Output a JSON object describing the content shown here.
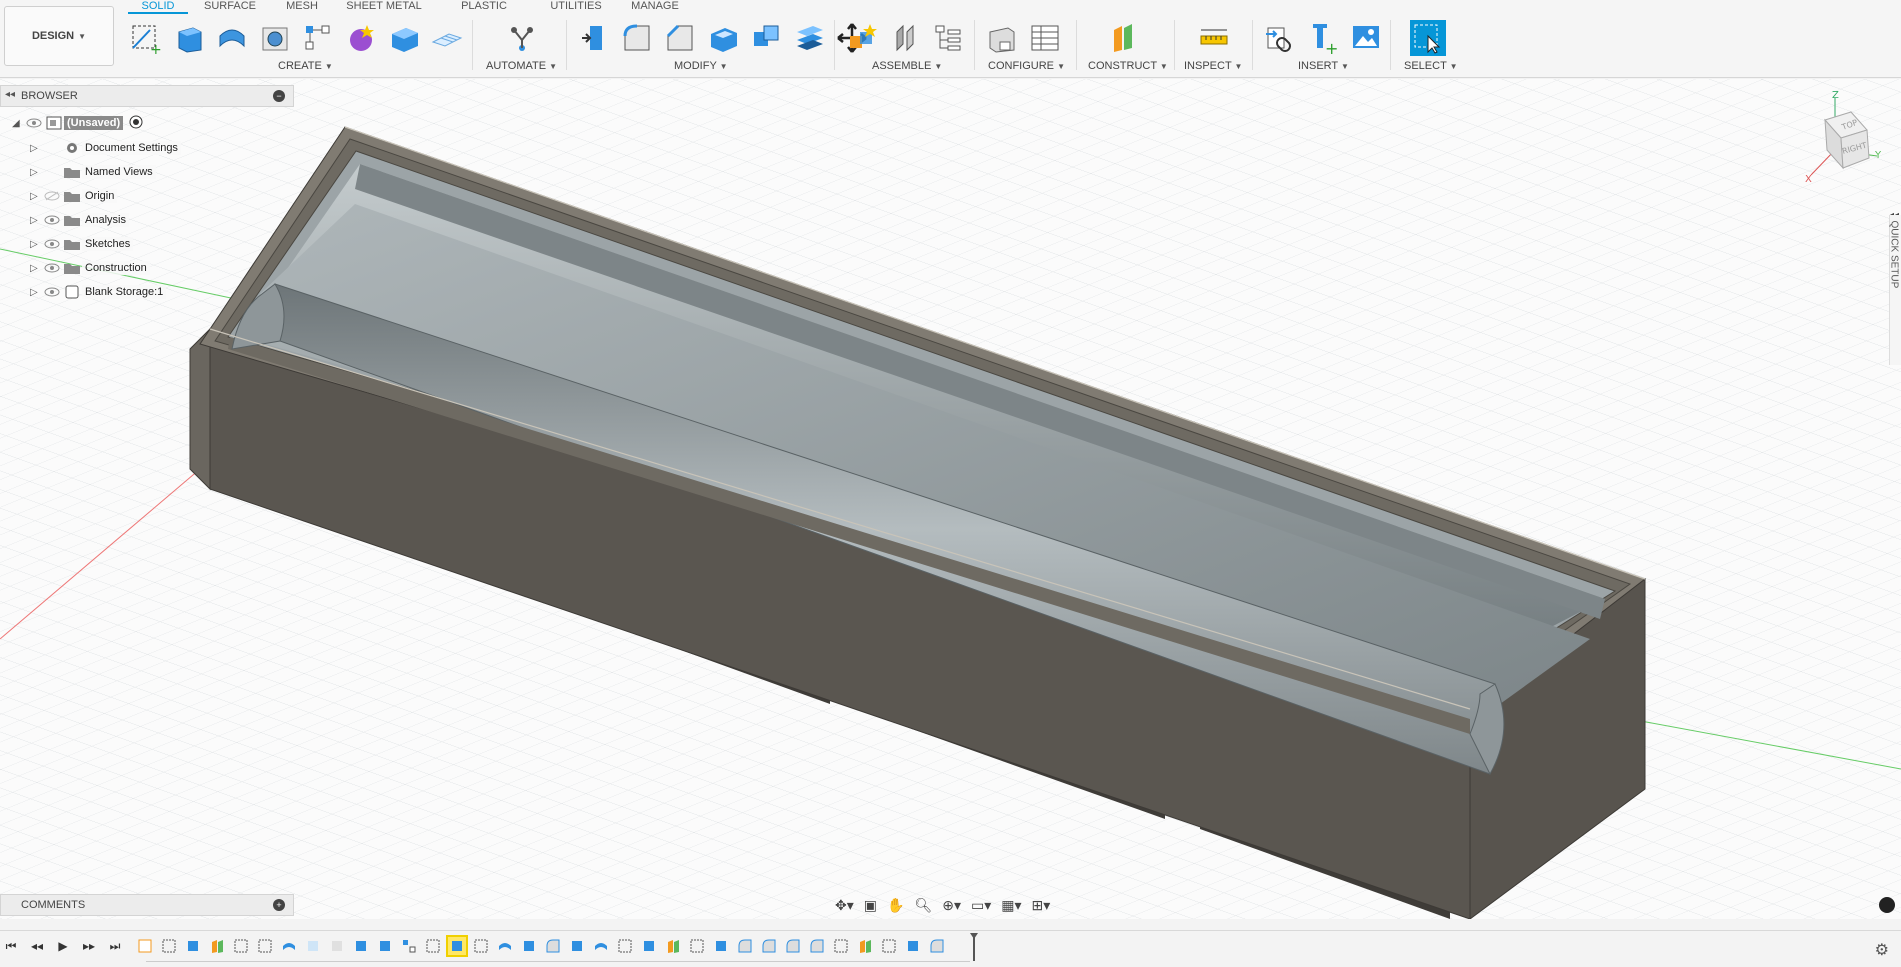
{
  "app": {
    "workspace_label": "DESIGN"
  },
  "tabs": [
    {
      "label": "SOLID",
      "active": true
    },
    {
      "label": "SURFACE",
      "active": false
    },
    {
      "label": "MESH",
      "active": false
    },
    {
      "label": "SHEET METAL",
      "active": false
    },
    {
      "label": "PLASTIC",
      "active": false
    },
    {
      "label": "UTILITIES",
      "active": false
    },
    {
      "label": "MANAGE",
      "active": false
    }
  ],
  "groups": {
    "create": "CREATE",
    "automate": "AUTOMATE",
    "modify": "MODIFY",
    "assemble": "ASSEMBLE",
    "configure": "CONFIGURE",
    "construct": "CONSTRUCT",
    "inspect": "INSPECT",
    "insert": "INSERT",
    "select": "SELECT"
  },
  "browser": {
    "title": "BROWSER",
    "items": [
      {
        "label": "(Unsaved)",
        "icon": "component-icon"
      },
      {
        "label": "Document Settings",
        "icon": "gear-icon"
      },
      {
        "label": "Named Views",
        "icon": "folder-icon"
      },
      {
        "label": "Origin",
        "icon": "folder-icon"
      },
      {
        "label": "Analysis",
        "icon": "folder-icon"
      },
      {
        "label": "Sketches",
        "icon": "folder-icon"
      },
      {
        "label": "Construction",
        "icon": "folder-icon"
      },
      {
        "label": "Blank Storage:1",
        "icon": "body-icon"
      }
    ]
  },
  "viewcube": {
    "face_top": "TOP",
    "face_right": "RIGHT",
    "axis_z": "Z",
    "axis_x": "X",
    "axis_y": "Y"
  },
  "quick_setup": "QUICK SETUP",
  "comments": {
    "title": "COMMENTS"
  },
  "colors": {
    "accent": "#0696d7",
    "body_outer": "#5a5650",
    "body_inner": "#8c9597",
    "grid": "#d9dde0"
  }
}
